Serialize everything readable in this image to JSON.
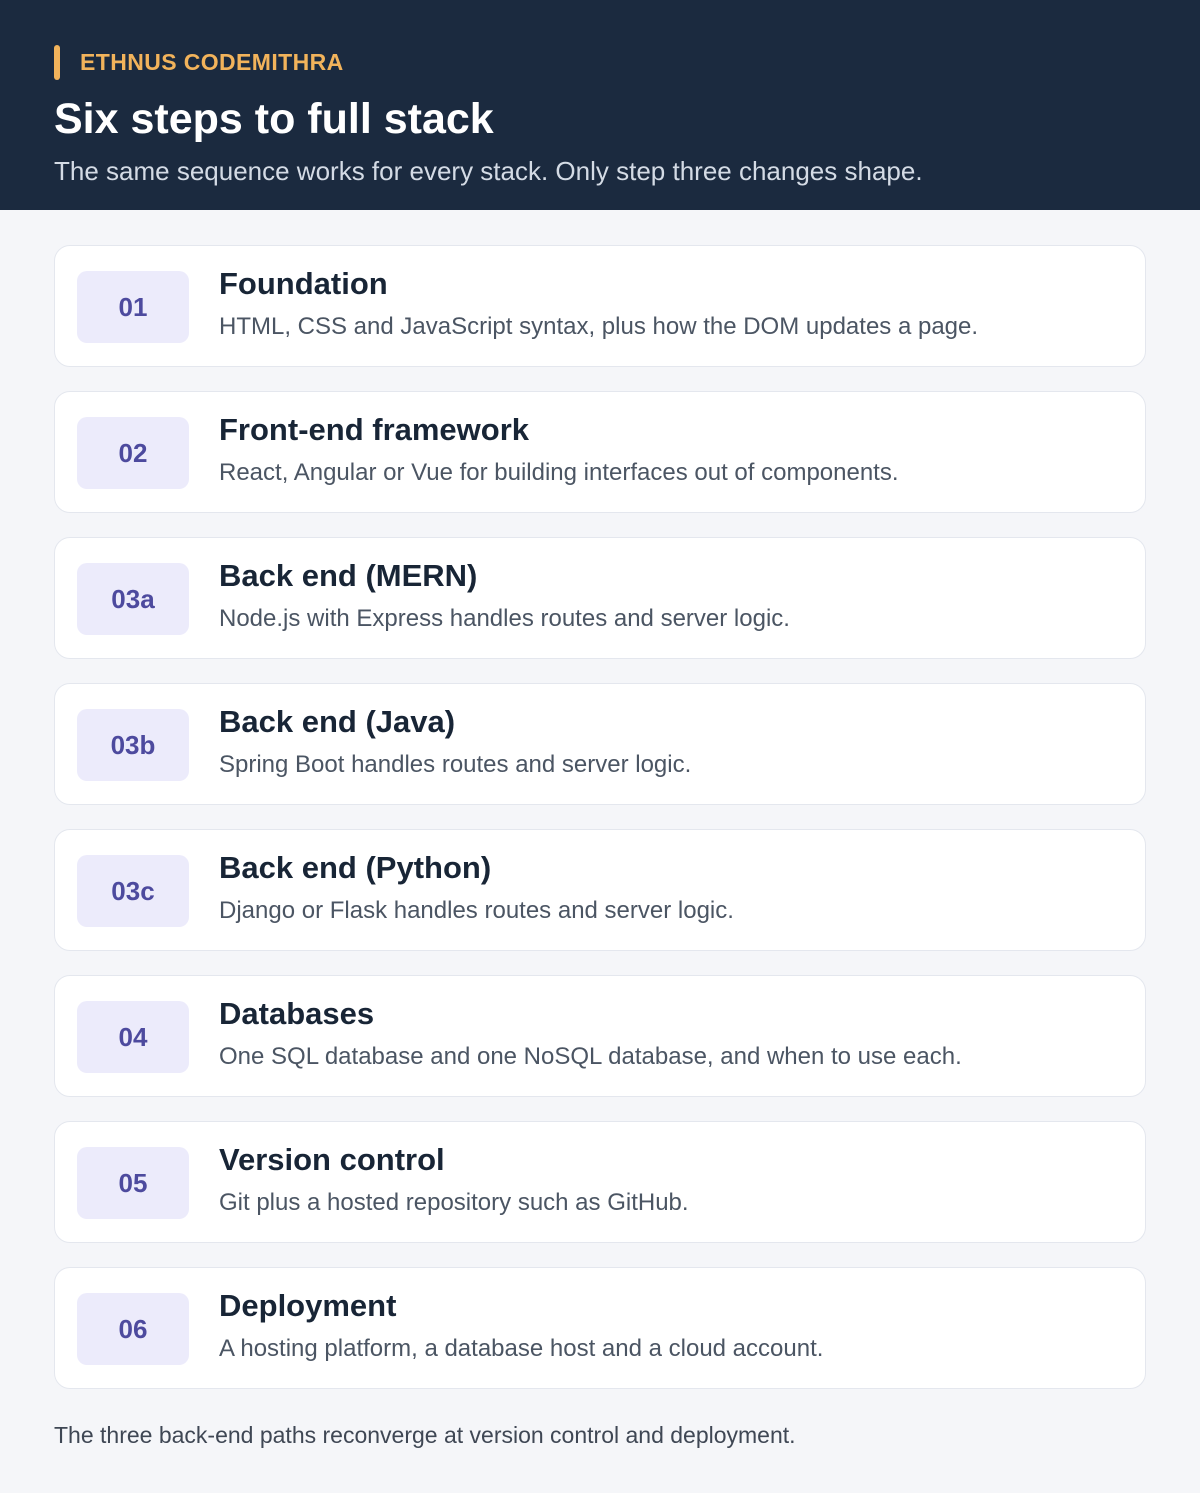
{
  "header": {
    "brand": "ETHNUS CODEMITHRA",
    "title": "Six steps to full stack",
    "subtitle": "The same sequence works for every stack. Only step three changes shape.",
    "colors": {
      "background": "#1b2a3f",
      "accent": "#f2b35b"
    }
  },
  "steps": [
    {
      "number": "01",
      "title": "Foundation",
      "description": "HTML, CSS and JavaScript syntax, plus how the DOM updates a page."
    },
    {
      "number": "02",
      "title": "Front-end framework",
      "description": "React, Angular or Vue for building interfaces out of components."
    },
    {
      "number": "03a",
      "title": "Back end (MERN)",
      "description": "Node.js with Express handles routes and server logic."
    },
    {
      "number": "03b",
      "title": "Back end (Java)",
      "description": "Spring Boot handles routes and server logic."
    },
    {
      "number": "03c",
      "title": "Back end (Python)",
      "description": "Django or Flask handles routes and server logic."
    },
    {
      "number": "04",
      "title": "Databases",
      "description": "One SQL database and one NoSQL database, and when to use each."
    },
    {
      "number": "05",
      "title": "Version control",
      "description": "Git plus a hosted repository such as GitHub."
    },
    {
      "number": "06",
      "title": "Deployment",
      "description": "A hosting platform, a database host and a cloud account."
    }
  ],
  "footer": {
    "note": "The three back-end paths reconverge at version control and deployment."
  }
}
